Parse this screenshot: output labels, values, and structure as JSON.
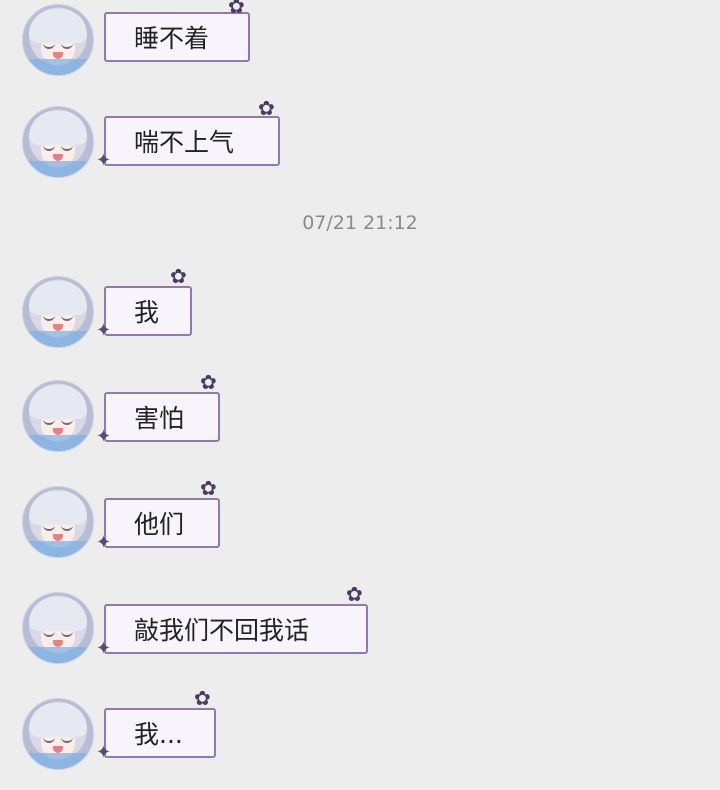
{
  "messages_before": [
    {
      "text": "睡不着"
    },
    {
      "text": "喘不上气"
    }
  ],
  "timestamp": "07/21 21:12",
  "messages_after": [
    {
      "text": "我"
    },
    {
      "text": "害怕"
    },
    {
      "text": "他们"
    },
    {
      "text": "敲我们不回我话"
    },
    {
      "text": "我..."
    }
  ],
  "icons": {
    "avatar": "avatar-icon",
    "bubble_decoration": "cat-sticker-icon"
  }
}
